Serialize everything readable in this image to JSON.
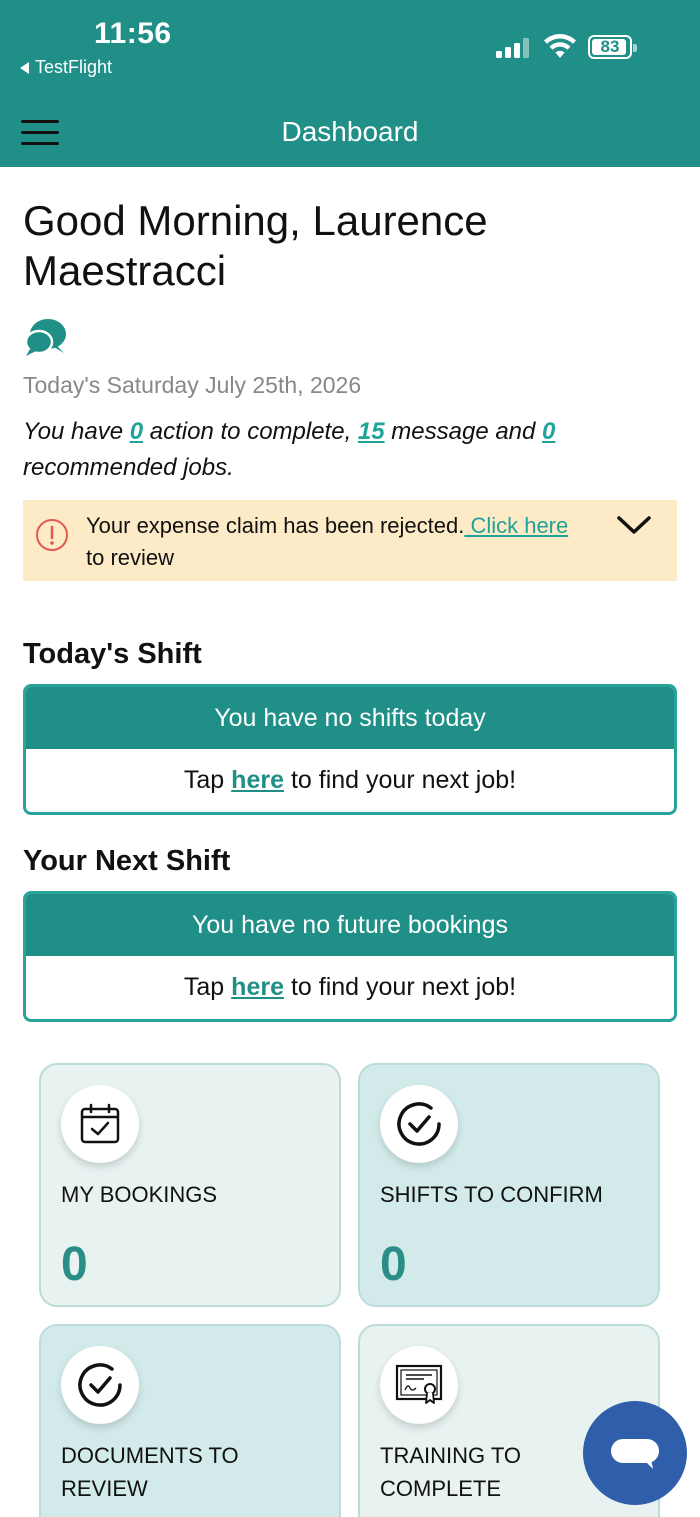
{
  "status_bar": {
    "time": "11:56",
    "back_app": "TestFlight",
    "battery": "83"
  },
  "header": {
    "title": "Dashboard",
    "menu_icon": "hamburger-icon",
    "background": "#1f8f87"
  },
  "greeting": {
    "text": "Good Morning, Laurence Maestracci",
    "chat_icon": "chat-bubbles-icon",
    "date": "Today's Saturday July 25th, 2026"
  },
  "summary": {
    "prefix": "You have ",
    "actions": "0",
    "mid1": " action to complete, ",
    "messages": "15",
    "mid2": " message and ",
    "jobs": "0",
    "suffix": " recommended jobs."
  },
  "alert": {
    "icon": "info-icon",
    "text": "Your expense claim has been rejected.",
    "link": " Click here",
    "trailing": " to review",
    "chevron_icon": "chevron-down-icon",
    "background": "#fdebc8"
  },
  "todays_shift": {
    "title": "Today's Shift",
    "banner": "You have no shifts today",
    "tap": "Tap",
    "link": "here",
    "rest": "to find your next job!"
  },
  "next_shift": {
    "title": "Your Next Shift",
    "banner": "You have no future bookings",
    "tap": "Tap",
    "link": "here",
    "rest": "to find your next job!"
  },
  "tiles": [
    {
      "label": "MY BOOKINGS",
      "count": "0",
      "icon": "calendar-check-icon"
    },
    {
      "label": "SHIFTS TO CONFIRM",
      "count": "0",
      "icon": "check-circle-icon"
    },
    {
      "label": "DOCUMENTS TO REVIEW",
      "count": "",
      "icon": "check-circle-icon"
    },
    {
      "label": "TRAINING TO COMPLETE",
      "count": "",
      "icon": "certificate-icon"
    }
  ],
  "fab": {
    "icon": "chat-icon",
    "color": "#2f5faa"
  }
}
